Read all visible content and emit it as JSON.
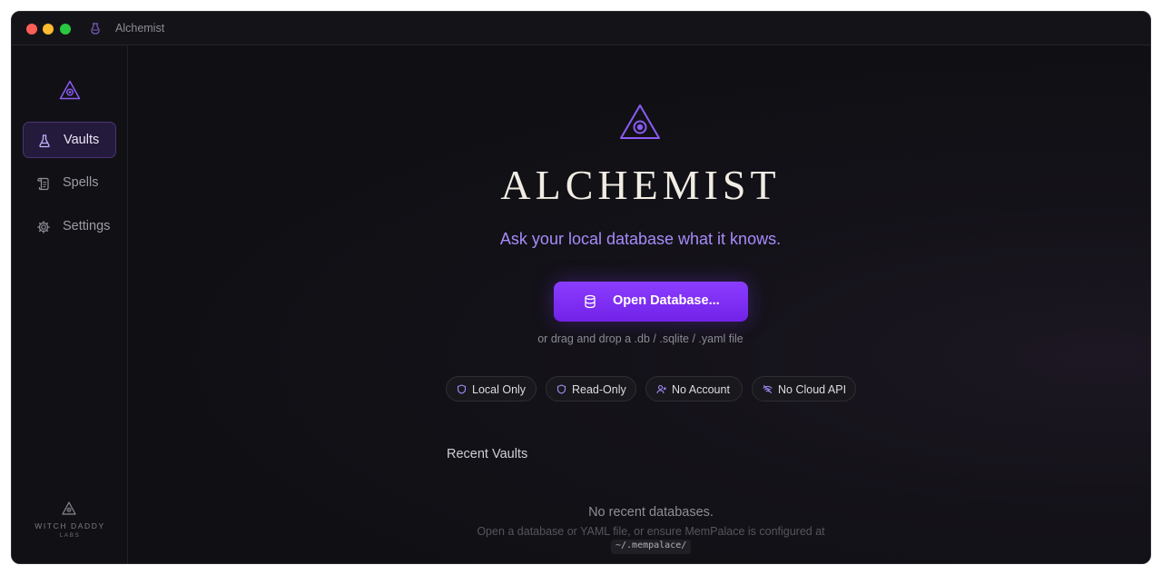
{
  "window": {
    "title": "Alchemist",
    "icons": {
      "app": "potion-icon"
    }
  },
  "sidebar": {
    "logo_icon": "eye-triangle-icon",
    "items": [
      {
        "label": "Vaults",
        "icon": "flask-icon",
        "active": true
      },
      {
        "label": "Spells",
        "icon": "scroll-icon",
        "active": false
      },
      {
        "label": "Settings",
        "icon": "gear-icon",
        "active": false
      }
    ],
    "brand": {
      "name": "WITCH DADDY",
      "sub": "LABS",
      "icon": "eye-triangle-icon"
    }
  },
  "main": {
    "title": "ALCHEMIST",
    "tagline": "Ask your local database what it knows.",
    "open_button": {
      "label": "Open Database...",
      "icon": "database-icon"
    },
    "drop_hint": "or drag and drop a .db / .sqlite / .yaml file",
    "badges": [
      {
        "label": "Local Only",
        "icon": "shield-icon"
      },
      {
        "label": "Read-Only",
        "icon": "shield-icon"
      },
      {
        "label": "No Account",
        "icon": "user-off-icon"
      },
      {
        "label": "No Cloud API",
        "icon": "wifi-off-icon"
      }
    ],
    "recent": {
      "title": "Recent Vaults",
      "empty_title": "No recent databases.",
      "empty_desc": "Open a database or YAML file, or ensure MemPalace is configured at",
      "empty_path": "~/.mempalace/"
    }
  },
  "colors": {
    "accent": "#8b3dff",
    "tagline": "#a78bfa",
    "background": "#0f0f13",
    "active_nav_bg": "#241a3b"
  }
}
